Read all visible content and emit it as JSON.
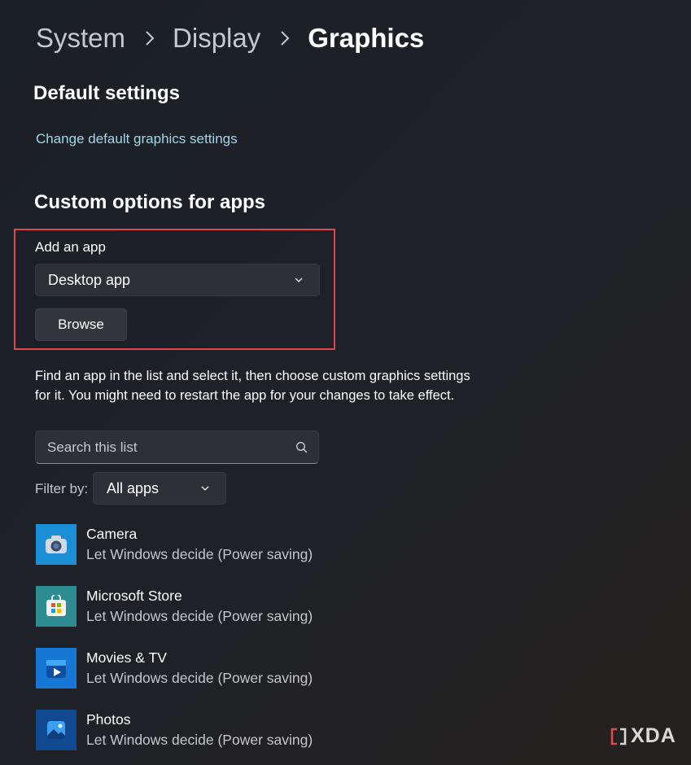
{
  "breadcrumb": {
    "items": [
      "System",
      "Display",
      "Graphics"
    ]
  },
  "default_settings": {
    "title": "Default settings",
    "link": "Change default graphics settings"
  },
  "custom_options": {
    "title": "Custom options for apps",
    "add_app_label": "Add an app",
    "app_type_selected": "Desktop app",
    "browse_label": "Browse",
    "description": "Find an app in the list and select it, then choose custom graphics settings for it. You might need to restart the app for your changes to take effect.",
    "search_placeholder": "Search this list",
    "filter_label": "Filter by:",
    "filter_selected": "All apps"
  },
  "apps": [
    {
      "name": "Camera",
      "setting": "Let Windows decide (Power saving)",
      "icon": "camera-icon"
    },
    {
      "name": "Microsoft Store",
      "setting": "Let Windows decide (Power saving)",
      "icon": "store-icon"
    },
    {
      "name": "Movies & TV",
      "setting": "Let Windows decide (Power saving)",
      "icon": "movies-icon"
    },
    {
      "name": "Photos",
      "setting": "Let Windows decide (Power saving)",
      "icon": "photos-icon"
    }
  ],
  "watermark": {
    "text": "XDA",
    "accent_color": "#e0484d"
  },
  "colors": {
    "link": "#9fd7e6",
    "highlight_border": "#e0484d"
  }
}
